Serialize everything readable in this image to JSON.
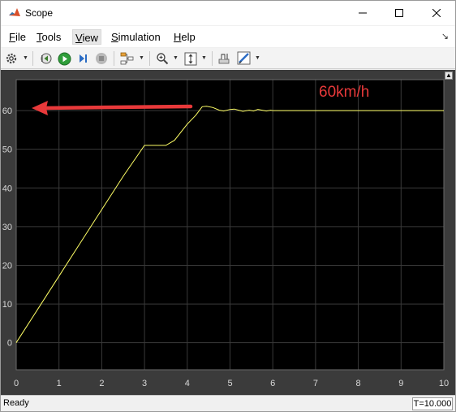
{
  "window": {
    "title": "Scope",
    "icon": "matlab-icon",
    "controls": [
      "minimize-icon",
      "maximize-icon",
      "close-icon"
    ]
  },
  "menu": {
    "items": [
      {
        "id": "file",
        "label": "File"
      },
      {
        "id": "tools",
        "label": "Tools"
      },
      {
        "id": "view",
        "label": "View"
      },
      {
        "id": "simulation",
        "label": "Simulation"
      },
      {
        "id": "help",
        "label": "Help"
      }
    ],
    "active": "View"
  },
  "toolbar": {
    "icons": [
      "settings-icon",
      "step-back-icon",
      "run-icon",
      "step-forward-icon",
      "stop-icon",
      "highlight-icon",
      "zoom-in-icon",
      "scale-axes-icon",
      "cursor-measure-icon",
      "edit-icon"
    ]
  },
  "plot": {
    "annotation": "60km/h",
    "arrow_color": "#e8393a",
    "line_color": "#ffff66",
    "background": "#000000"
  },
  "chart_data": {
    "type": "line",
    "title": "",
    "xlabel": "",
    "ylabel": "",
    "xlim": [
      0,
      10
    ],
    "ylim": [
      -7,
      68
    ],
    "xticks": [
      "0",
      "1",
      "2",
      "3",
      "4",
      "5",
      "6",
      "7",
      "8",
      "9",
      "10"
    ],
    "yticks": [
      "0",
      "10",
      "20",
      "30",
      "40",
      "50",
      "60"
    ],
    "grid": true,
    "series": [
      {
        "x": [
          0,
          0.5,
          1,
          1.5,
          2,
          2.5,
          3,
          3.5,
          3.7,
          4,
          4.2,
          4.35,
          4.45,
          4.6,
          4.75,
          4.85,
          5.0,
          5.1,
          5.2,
          5.3,
          5.45,
          5.55,
          5.65,
          5.75,
          5.85,
          5.95,
          6.0,
          7,
          8,
          9,
          10
        ],
        "y": [
          0,
          8.6,
          17.2,
          25.8,
          34.4,
          43.0,
          51.0,
          51.0,
          52.3,
          56.5,
          58.8,
          61.0,
          61.1,
          60.8,
          60.1,
          59.9,
          60.3,
          60.4,
          60.1,
          59.8,
          60.1,
          59.9,
          60.3,
          60.1,
          59.9,
          60.1,
          60.0,
          60.0,
          60.0,
          60.0,
          60.0
        ]
      }
    ]
  },
  "status": {
    "text": "Ready",
    "time": "T=10.000"
  }
}
